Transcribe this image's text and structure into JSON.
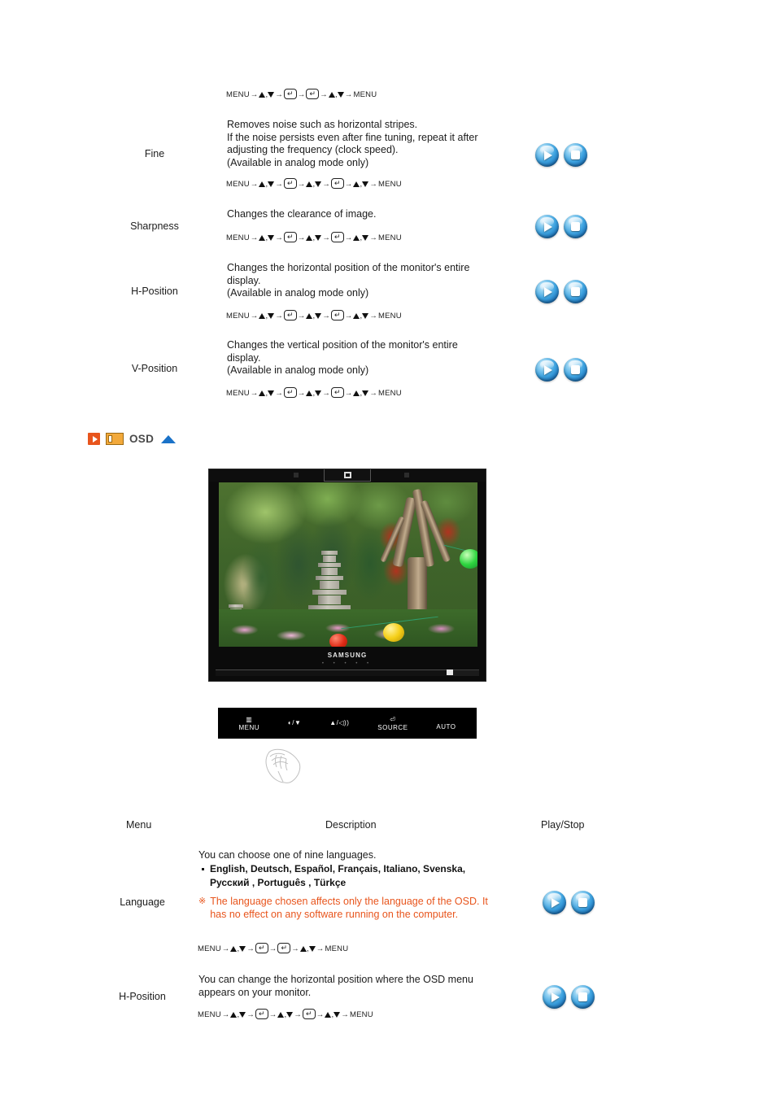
{
  "nav": {
    "menu": "MENU",
    "enter_glyph": "↵",
    "arrow": "→",
    "comma": ",",
    "seq_short": "MENU → ▲ , ▼ → ↵ → ↵ → ▲ , ▼ → MENU",
    "seq_long": "MENU → ▲ , ▼ → ↵ → ▲ , ▼ → ↵ → ▲ , ▼ → MENU"
  },
  "top_section": {
    "lead_sequence_type": "short",
    "rows": [
      {
        "label": "Fine",
        "description": "Removes noise such as horizontal stripes.\nIf the noise persists even after fine tuning, repeat it after\nadjusting the frequency (clock speed).\n(Available in analog mode only)",
        "sequence_type": "long",
        "controls": [
          "play",
          "stop"
        ]
      },
      {
        "label": "Sharpness",
        "description": "Changes the clearance of image.",
        "sequence_type": "long",
        "controls": [
          "play",
          "stop"
        ]
      },
      {
        "label": "H-Position",
        "description": "Changes the horizontal position of the monitor's entire\ndisplay.\n(Available in analog mode only)",
        "sequence_type": "long",
        "controls": [
          "play",
          "stop"
        ]
      },
      {
        "label": "V-Position",
        "description": "Changes the vertical position of the monitor's entire\ndisplay.\n(Available in analog mode only)",
        "sequence_type": "long",
        "controls": [
          "play",
          "stop"
        ]
      }
    ]
  },
  "osd_section": {
    "title": "OSD",
    "arrow_icon": "play-arrow-icon",
    "osd_icon": "osd-panel-icon",
    "top_icon": "go-to-top-icon"
  },
  "monitor": {
    "brand": "SAMSUNG",
    "dots": "• • • • •",
    "screen_alt": "Korean garden with stone pagoda, trees, flowers and paper lanterns",
    "buttons": [
      {
        "glyph": "▥",
        "label": "MENU",
        "name": "menu-button"
      },
      {
        "glyph": "◕/▼",
        "label": "",
        "name": "brightness-down-button"
      },
      {
        "glyph": "▲/◀))",
        "label": "",
        "name": "volume-up-button"
      },
      {
        "glyph": "⏎",
        "label": "SOURCE",
        "name": "source-button"
      },
      {
        "glyph": "",
        "label": "AUTO",
        "name": "auto-button"
      }
    ]
  },
  "table": {
    "headers": {
      "menu": "Menu",
      "description": "Description",
      "play_stop": "Play/Stop"
    },
    "rows": [
      {
        "label": "Language",
        "intro": "You can choose one of nine languages.",
        "languages": "English, Deutsch, Español, Français,  Italiano, Svenska,\nРусский , Português , Türkçe",
        "warning_mark": "※",
        "warning": "The language chosen affects only the language of the OSD. It\nhas no effect on any software running on the computer.",
        "sequence_type": "short",
        "controls": [
          "play",
          "stop"
        ]
      },
      {
        "label": "H-Position",
        "description": "You can change the horizontal position where the OSD menu\nappears on your monitor.",
        "sequence_type": "long",
        "controls": [
          "play",
          "stop"
        ]
      }
    ]
  },
  "colors": {
    "accent_orange": "#e8551d",
    "osd_icon_fill": "#f2a93b",
    "top_arrow_blue": "#1a72c8",
    "orb_blue": "#3ea3e0",
    "text": "#1c1c1c"
  }
}
